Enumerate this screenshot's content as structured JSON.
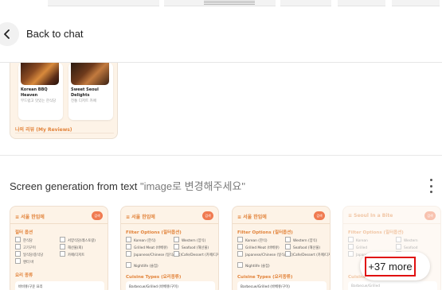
{
  "header": {
    "back_label": "Back to chat"
  },
  "preview": {
    "places": [
      {
        "title": "Korean BBQ Heaven",
        "subtitle": "부드럽고 맛있는 한식당"
      },
      {
        "title": "Sweet Seoul Delights",
        "subtitle": "전통 디저트 카페"
      }
    ],
    "reviews_title": "나의 리뷰 (My Reviews)"
  },
  "generation": {
    "title_prefix": "Screen generation from text ",
    "title_quote": "\"image로 변경해주세요\""
  },
  "thumbs": [
    {
      "head": "≡ 서울 한입에",
      "badge": "검색",
      "section1": "필터 옵션",
      "options": [
        "한식당",
        "서양식당(레스토랑)",
        "고기구이",
        "해산물(회)",
        "일식당/중식당",
        "카페/디저트",
        "앤터 바"
      ],
      "section2": "요리 종류",
      "panel": "바비큐/구운 요리"
    },
    {
      "head": "≡ 서울 한입에",
      "badge": "검색",
      "section1": "Filter Options (필터옵션)",
      "options": [
        "Korean (한식)",
        "Western (양식)",
        "Grilled Meat (바베큐)",
        "Seafood (해산물)",
        "Japanese/Chinese (일식/중식)",
        "Cafe/Dessert (카페/디저트)",
        "Nightlife (술집)"
      ],
      "section2": "Cuisine Types (요리종류)",
      "panel": "Barbecue/Grilled (바베큐/구이)"
    },
    {
      "head": "≡ 서울 한입에",
      "badge": "검색",
      "section1": "Filter Options (필터옵션)",
      "options": [
        "Korean (한식)",
        "Western (양식)",
        "Grilled Meat (바베큐)",
        "Seafood (해산물)",
        "Japanese/Chinese (일식/중식)",
        "Cafe/Dessert (카페/디저트)",
        "Nightlife (술집)"
      ],
      "section2": "Cuisine Types (요리종류)",
      "panel": "Barbecue/Grilled (바베큐/구이)"
    },
    {
      "head": "≡ Seoul In a Bite",
      "badge": "검색",
      "section1": "Filter Options (필터옵션)",
      "options": [
        "Korean",
        "Western",
        "Grilled",
        "Seafood",
        "Japanese",
        "Cafe"
      ],
      "section2": "Cuisine Types (요리종류)",
      "panel": "Barbecue/Grilled"
    }
  ],
  "more_label": "+37 more",
  "colors": {
    "accent": "#e2833a",
    "highlight_border": "#e01010",
    "card_bg": "#fdf3e7"
  }
}
